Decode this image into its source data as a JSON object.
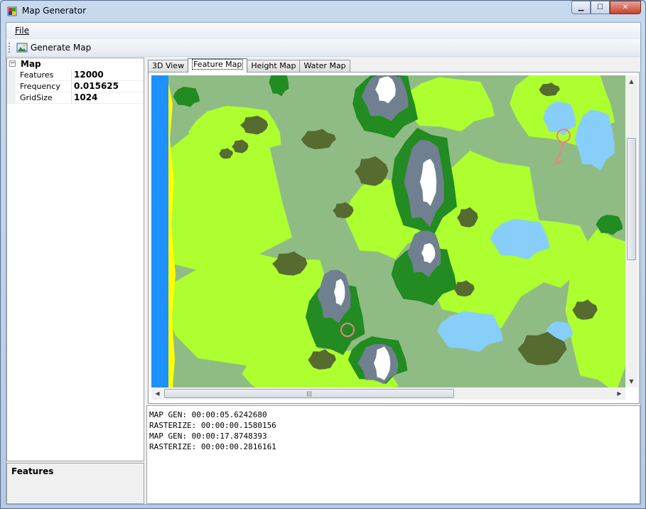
{
  "window": {
    "title": "Map Generator"
  },
  "menu": {
    "file_label": "File"
  },
  "toolbar": {
    "generate_label": "Generate Map"
  },
  "properties": {
    "category": "Map",
    "rows": [
      {
        "name": "Features",
        "value": "12000"
      },
      {
        "name": "Frequency",
        "value": "0.015625"
      },
      {
        "name": "GridSize",
        "value": "1024"
      }
    ]
  },
  "help": {
    "title": "Features"
  },
  "tabs": [
    "3D View",
    "Feature Map",
    "Height Map",
    "Water Map"
  ],
  "active_tab": "Feature Map",
  "map_colors": {
    "ocean": "#1e90ff",
    "beach": "#ffff00",
    "lowland": "#adff2f",
    "grass": "#8fbc84",
    "forest": "#228b22",
    "hills": "#556b2f",
    "mountain": "#708090",
    "snow": "#ffffff",
    "lake": "#87cefa",
    "road": "#f08080"
  },
  "log": [
    "MAP GEN: 00:00:05.6242680",
    "RASTERIZE: 00:00:00.1580156",
    "MAP GEN: 00:00:17.8748393",
    "RASTERIZE: 00:00:00.2816161"
  ]
}
